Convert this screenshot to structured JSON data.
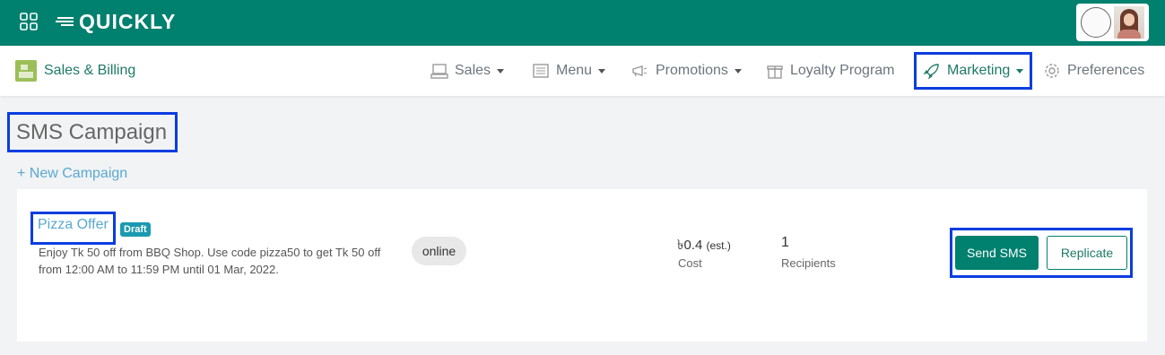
{
  "app": {
    "logo_text": "QUICKLY"
  },
  "nav": {
    "brand": "Sales & Billing",
    "items": [
      {
        "label": "Sales",
        "icon": "register-icon",
        "has_dropdown": true
      },
      {
        "label": "Menu",
        "icon": "menu-icon",
        "has_dropdown": true
      },
      {
        "label": "Promotions",
        "icon": "megaphone-icon",
        "has_dropdown": true
      },
      {
        "label": "Loyalty Program",
        "icon": "gift-icon",
        "has_dropdown": false
      },
      {
        "label": "Marketing",
        "icon": "rocket-icon",
        "has_dropdown": true,
        "active": true
      },
      {
        "label": "Preferences",
        "icon": "gear-icon",
        "has_dropdown": false
      }
    ]
  },
  "page": {
    "title": "SMS Campaign",
    "new_campaign": "+ New Campaign"
  },
  "campaign": {
    "name": "Pizza Offer",
    "status": "Draft",
    "description": "Enjoy Tk 50 off from BBQ Shop. Use code pizza50 to get Tk 50 off from 12:00 AM to 11:59 PM until 01 Mar, 2022.",
    "channel": "online",
    "cost_value": "৳0.4",
    "cost_est": "(est.)",
    "cost_label": "Cost",
    "recipients_value": "1",
    "recipients_label": "Recipients",
    "send_label": "Send SMS",
    "replicate_label": "Replicate"
  },
  "colors": {
    "primary": "#00806e",
    "link": "#5aa8cf",
    "badge": "#1a9ab0",
    "highlight": "#0a3de0"
  }
}
